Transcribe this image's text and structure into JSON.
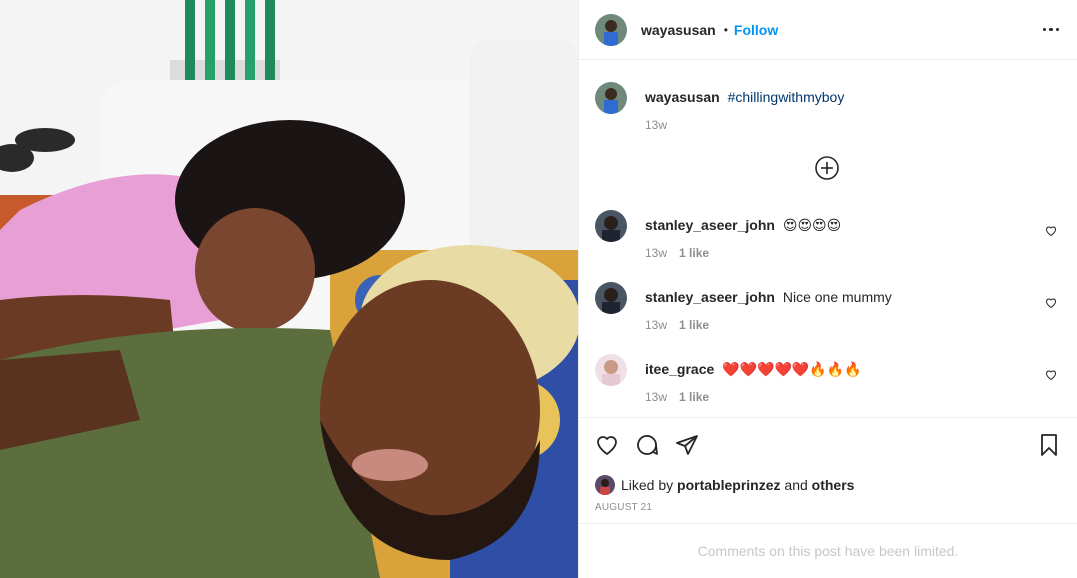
{
  "post": {
    "author": "wayasusan",
    "separator": "•",
    "follow_label": "Follow",
    "more_icon": "more-options-icon"
  },
  "caption": {
    "username": "wayasusan",
    "text": "#chillingwithmyboy",
    "time": "13w"
  },
  "comments": [
    {
      "username": "stanley_aseer_john",
      "text": "😍😍😍😍",
      "time": "13w",
      "likes": "1 like"
    },
    {
      "username": "stanley_aseer_john",
      "text": "Nice one mummy",
      "time": "13w",
      "likes": "1 like"
    },
    {
      "username": "itee_grace",
      "text": "❤️❤️❤️❤️❤️🔥🔥🔥",
      "time": "13w",
      "likes": "1 like"
    }
  ],
  "liked_by": {
    "prefix": "Liked by",
    "user": "portableprinzez",
    "joiner": "and",
    "others": "others"
  },
  "date": "AUGUST 21",
  "comments_limited": "Comments on this post have been limited.",
  "colors": {
    "accent": "#0095f6",
    "hashtag": "#00376b",
    "muted": "#8e8e8e",
    "border": "#efefef"
  }
}
